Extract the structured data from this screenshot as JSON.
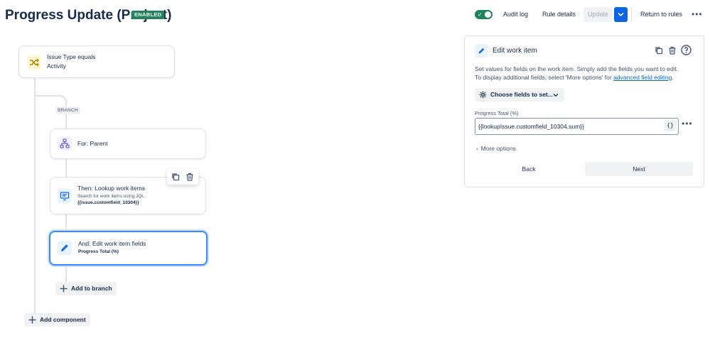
{
  "header": {
    "title": "Progress Update (Project)",
    "status_badge": "ENABLED",
    "audit_log": "Audit log",
    "rule_details": "Rule details",
    "update": "Update",
    "return_to_rules": "Return to rules"
  },
  "flow": {
    "trigger": {
      "label": "Issue Type equals",
      "sub": "Activity"
    },
    "branch_tag": "BRANCH",
    "for_card": {
      "label": "For: Parent"
    },
    "lookup_card": {
      "label": "Then: Lookup work items",
      "sub1": "Search for work items using JQL",
      "sub2": "{{issue.customfield_10304}}"
    },
    "edit_card": {
      "label": "And: Edit work item fields",
      "sub": "Progress Total (%)"
    },
    "add_to_branch": "Add to branch",
    "add_component": "Add component"
  },
  "panel": {
    "title": "Edit work item",
    "desc_line1": "Set values for fields on the work item. Simply add the fields you want to edit.",
    "desc_line2": "To display additional fields, select 'More options' for ",
    "desc_link": "advanced field editing",
    "desc_end": ".",
    "choose_fields": "Choose fields to set...",
    "field_label": "Progress Total (%)",
    "field_value": "{{lookupIssue.customfield_10304.sum}}",
    "smart_value": "{}",
    "more_options": "More options",
    "back": "Back",
    "next": "Next"
  },
  "colors": {
    "brand": "#0c66e4",
    "enabled_green": "#1f845a",
    "selected_border": "#388bff",
    "trigger_icon_bg": "#fff7d6",
    "component_icon_bg": "#f3f0ff"
  }
}
